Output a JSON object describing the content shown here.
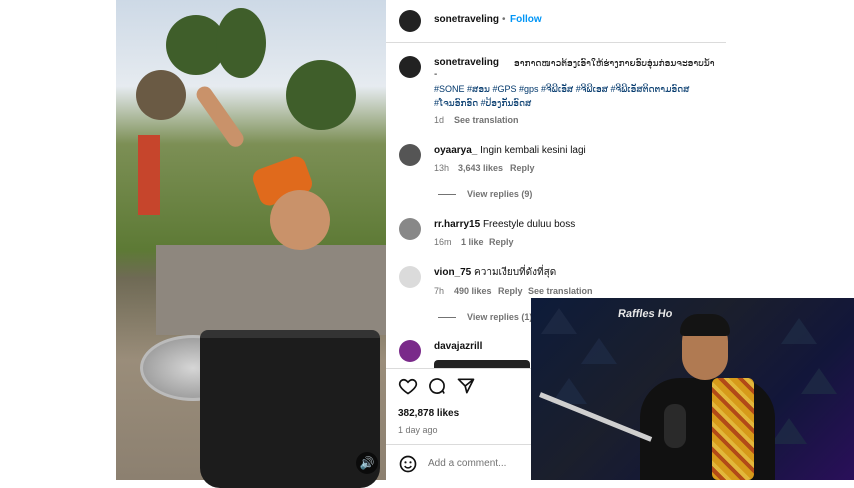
{
  "post": {
    "username": "sonetraveling",
    "follow_label": "Follow"
  },
  "caption": {
    "username": "sonetraveling",
    "text_line1": "ອາກາດໜາວຕ້ອງເອົາໃຫ້ຮ່າງກາຍອົບອຸ່ນກ່ອນຈະອາບນ້ຳ",
    "text_line2": "-",
    "hashtags_line1": "#SONE #ສອນ #GPS #gps #ຈີພີເອັສ #ຈີພີເອສ #ຈີພີເອັສຕິດຕາມອົດສ",
    "hashtags_line2": "#ໂຈນອົກອົດ #ປ້ອງກັນອົດສ",
    "time": "1d",
    "see_translation": "See translation"
  },
  "comments": [
    {
      "username": "oyaarya_",
      "text": "Ingin kembali kesini lagi",
      "time": "13h",
      "likes": "3,643 likes",
      "reply": "Reply",
      "view_replies": "View replies (9)"
    },
    {
      "username": "rr.harry15",
      "text": "Freestyle duluu boss",
      "time": "16m",
      "likes": "1 like",
      "reply": "Reply"
    },
    {
      "username": "vion_75",
      "text": "ความเงียบที่ดังที่สุด",
      "time": "7h",
      "likes": "490 likes",
      "reply": "Reply",
      "see_translation": "See translation",
      "view_replies": "View replies (1)"
    },
    {
      "username": "davajazrill"
    }
  ],
  "actions": {
    "likes_count": "382,878 likes",
    "time_ago": "1 day ago",
    "comment_placeholder": "Add a comment..."
  },
  "icons": {
    "like": "heart-icon",
    "comment": "comment-icon",
    "share": "share-icon",
    "emoji": "emoji-icon",
    "sound": "sound-icon"
  },
  "overlay": {
    "sign_text": "Raffles Ho"
  }
}
